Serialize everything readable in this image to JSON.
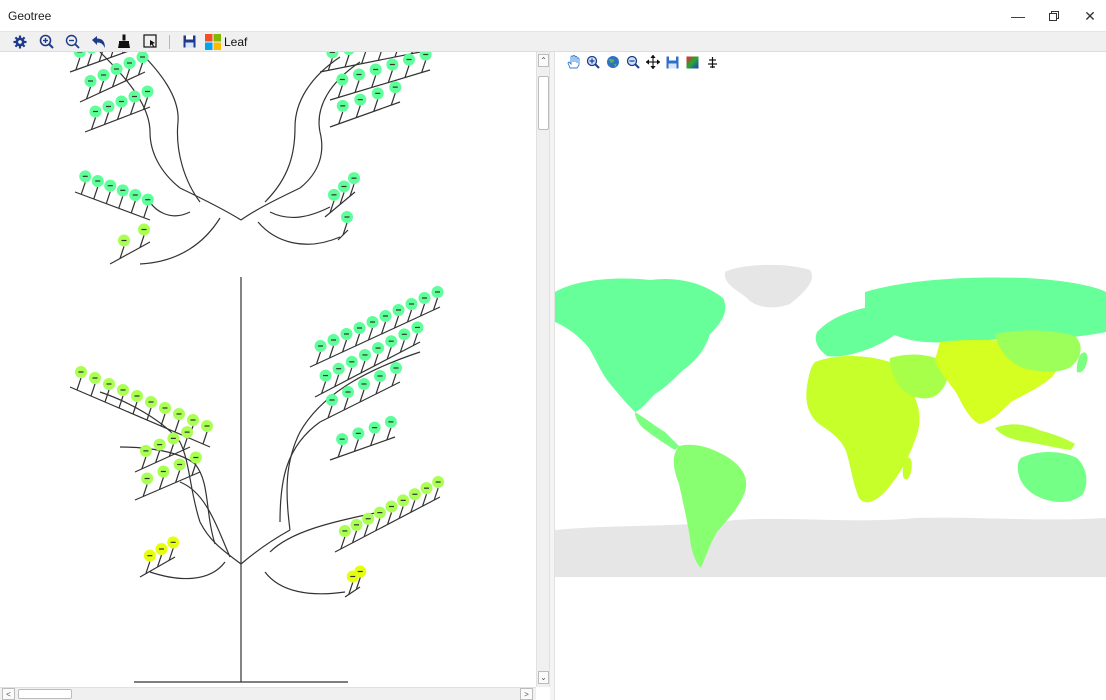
{
  "window": {
    "title": "Geotree",
    "controls": [
      "minimize-icon",
      "restore-icon",
      "close-icon"
    ]
  },
  "toolbar": {
    "icons": [
      "gear-icon",
      "zoom-in-icon",
      "zoom-out-icon",
      "undo-icon",
      "brush-icon",
      "select-icon",
      "save-icon"
    ],
    "leaf_label": "Leaf"
  },
  "map_toolbar": {
    "icons": [
      "hand-icon",
      "zoom-in-icon",
      "globe-icon",
      "zoom-out-icon",
      "pan-icon",
      "save-icon",
      "color-palette-icon",
      "align-icon"
    ]
  },
  "colors": {
    "leaf_high": "#5eff9a",
    "leaf_mid": "#a9ff52",
    "leaf_low": "#e6ff10",
    "land": "#66ff99",
    "land_warm": "#c6ff2a",
    "ice": "#e6e6e6"
  }
}
